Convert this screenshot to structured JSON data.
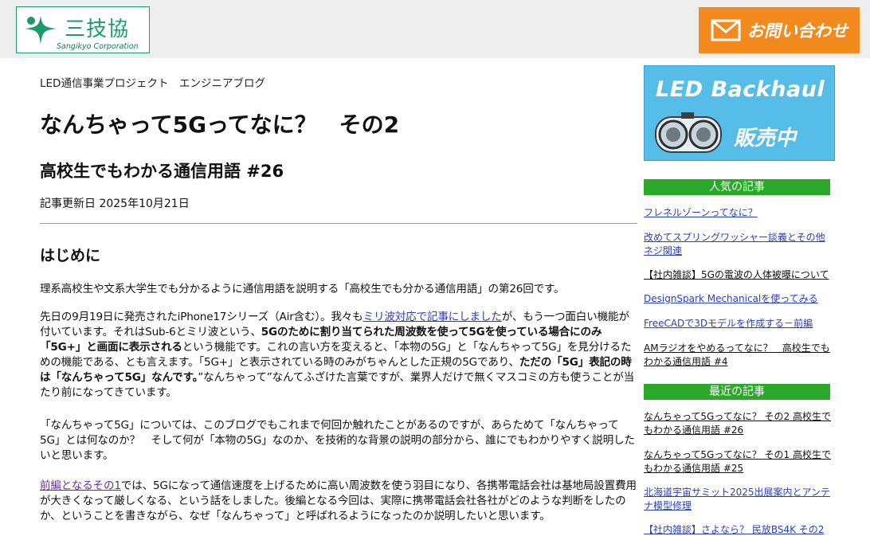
{
  "header": {
    "logo_text": "三技協",
    "logo_sub": "Sangikyo Corporation",
    "contact_label": "お問い合わせ"
  },
  "article": {
    "category": "LED通信事業プロジェクト　エンジニアブログ",
    "title": "なんちゃって5Gってなに？　その2",
    "subtitle": "高校生でもわかる通信用語 #26",
    "date": "記事更新日 2025年10月21日",
    "heading": "はじめに",
    "p1": "理系高校生や文系大学生でも分かるように通信用語を説明する「高校生でも分かる通信用語」の第26回です。",
    "p2": {
      "s1": "先日の9月19日に発売されたiPhone17シリーズ（Air含む）。我々も",
      "link": "ミリ波対応で記事にしました",
      "s2": "が、もう一つ面白い機能が付いています。それはSub-6とミリ波という、",
      "b1": "5Gのために割り当てられた周波数を使って5Gを使っている場合にのみ「5G+」と画面に表示される",
      "s3": "という機能です。これの言い方を変えると、「本物の5G」と「なんちゃって5G」を見分けるための機能である、とも言えます。「5G+」と表示されている時のみがちゃんとした正規の5Gであり、",
      "b2": "ただの「5G」表記の時は「なんちゃって5G」なんです。",
      "s4": "”なんちゃって”なんてふざけた言葉ですが、業界人だけで無くマスコミの方も使うことが当たり前になってきています。"
    },
    "p3": "「なんちゃって5G」については、このブログでもこれまで何回か触れたことがあるのですが、あらためて「なんちゃって5G」とは何なのか？　そして何が「本物の5G」なのか、を技術的な背景の説明の部分から、誰にでもわかりやすく説明したいと思います。",
    "p4": {
      "link": "前編となるその1",
      "text": "では、5Gになって通信速度を上げるために高い周波数を使う羽目になり、各携帯電話会社は基地局設置費用が大きくなって厳しくなる、という話をしました。後編となる今回は、実際に携帯電話会社各社がどのような判断をしたのか、ということを書きながら、なぜ「なんちゃって」と呼ばれるようになったのか説明したいと思います。"
    }
  },
  "sidebar": {
    "banner_title": "LED Backhaul",
    "banner_sub": "販売中",
    "popular_heading": "人気の記事",
    "popular": [
      "フレネルゾーンってなに？",
      "改めてスプリングワッシャー談義とその他ネジ関連",
      "【社内雑談】5Gの電波の人体被曝について",
      "DesignSpark Mechanicalを使ってみる",
      "FreeCADで3Dモデルを作成する－前編",
      "AMラジオをやめるってなに？　高校生でもわかる通信用語 #4"
    ],
    "recent_heading": "最近の記事",
    "recent": [
      "なんちゃって5Gってなに？ その2 高校生でもわかる通信用語 #26",
      "なんちゃって5Gってなに？ その1 高校生でもわかる通信用語 #25",
      "北海道宇宙サミット2025出展案内とアンテナ模型修理",
      "【社内雑談】さよなら？ 民放BS4K その2"
    ]
  },
  "colors": {
    "brand_green": "#1a9b6b",
    "contact_orange": "#f28a1e",
    "banner_blue": "#55bde8",
    "section_green": "#2aa82a",
    "link_blue": "#2a3fb8"
  }
}
